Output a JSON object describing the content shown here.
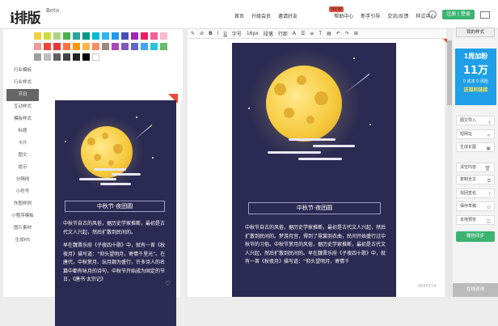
{
  "header": {
    "logo": "i排版",
    "logo_badge": "Beta",
    "nav": [
      "首页",
      "升级会员",
      "邀请好友",
      "帮助中心",
      "新手引导",
      "交流/反馈",
      "样式中心"
    ],
    "nav_badge": "NEW",
    "login_label": "注册 | 登录",
    "user_icon": "user-icon",
    "mail_icon": "mail-icon"
  },
  "palette": {
    "colors": [
      "#f4d03f",
      "#cddc39",
      "#aed581",
      "#4caf50",
      "#26a69a",
      "#009688",
      "#00bcd4",
      "#29b6f6",
      "#2196f3",
      "#3f51b5",
      "#9c27b0",
      "#e91e63",
      "#f06292",
      "#f8bbd0",
      "#ef9a9a",
      "#f44336",
      "#e53935",
      "#ff7043",
      "#ff9800",
      "#ffb74d",
      "#ff8a65",
      "#a1887f",
      "#ab47bc",
      "#7e57c2",
      "#5c6bc0",
      "#42a5f5",
      "#26c6da",
      "#66bb6a",
      "#9e9e9e",
      "#bdbdbd",
      "#616161",
      "#424242",
      "#212121",
      "#000000",
      "#ffffff"
    ]
  },
  "sidebar": {
    "items": [
      "行业模板",
      "行业样式",
      "节日",
      "互动样式",
      "模板样式",
      "标题",
      "卡片",
      "图文",
      "提示",
      "分隔线",
      "小符号",
      "作图样例",
      "小程序模板",
      "图片素材",
      "生成H5"
    ],
    "active_index": 2
  },
  "toolbar": {
    "items": [
      "✎",
      "⊘",
      "B",
      "I",
      "U",
      "字号",
      "16px",
      "段落",
      "行距",
      "A",
      "☰",
      "≡",
      "T",
      "▤",
      "↶",
      "↷",
      "⊞"
    ]
  },
  "preview_small": {
    "title": "中秋节·夜团圆",
    "paragraphs": [
      "中秋节自古的风俗，据历史学家推断，最初是古代文人兴起，然后扩散到民间的。",
      "早在魏晋乐府《子夜四十歌》中，就有一首《秋夜月》描写道：“仰头望明月，寄情千里光”。在唐代，中秋赏月、玩月颇为盛行，许多诗人的名篇中都有咏月的诗句，中秋节开始成为固定的节日，《唐书·太宗记》"
    ]
  },
  "preview_main": {
    "title": "中秋节·夜团圆",
    "paragraphs": [
      "中秋节自古的风俗，据历史学家推断，最初是古代文人兴起，然后扩散到民间的。梦游月宫，得到了霓裳羽衣曲，民间开始盛行过中秋节的习俗。中秋节赏月的风俗，据历史学家推断，最初是古代文人兴起，然后扩散到民间的。早在魏晋乐府《子夜四十歌》中，就有一首《秋夜月》描写道：“仰头望明月，寄情千"
    ],
    "word_count": "0695574"
  },
  "right_panel": {
    "tab": "我的样式",
    "ad": {
      "l1": "1周加粉",
      "l2": "11万",
      "l3": "0 成本 0 风险",
      "l4": "送福利链接"
    },
    "buttons": [
      {
        "label": "图文导入",
        "icon": "import-icon",
        "glyph": "⤓"
      },
      {
        "label": "短网址",
        "icon": "link-icon",
        "glyph": "∞"
      },
      {
        "label": "生成长图",
        "icon": "image-icon",
        "glyph": "▣"
      },
      {
        "label": "清空内容",
        "icon": "trash-icon",
        "glyph": "🗑"
      },
      {
        "label": "复制全文",
        "icon": "copy-icon",
        "glyph": "⧉"
      },
      {
        "label": "找回签名",
        "icon": "question-icon",
        "glyph": "?"
      },
      {
        "label": "保存草稿",
        "icon": "save-icon",
        "glyph": "⊙"
      },
      {
        "label": "本地预览",
        "icon": "preview-icon",
        "glyph": "◫"
      }
    ],
    "sync_label": "微信同步",
    "online_label": "在线咨询"
  }
}
